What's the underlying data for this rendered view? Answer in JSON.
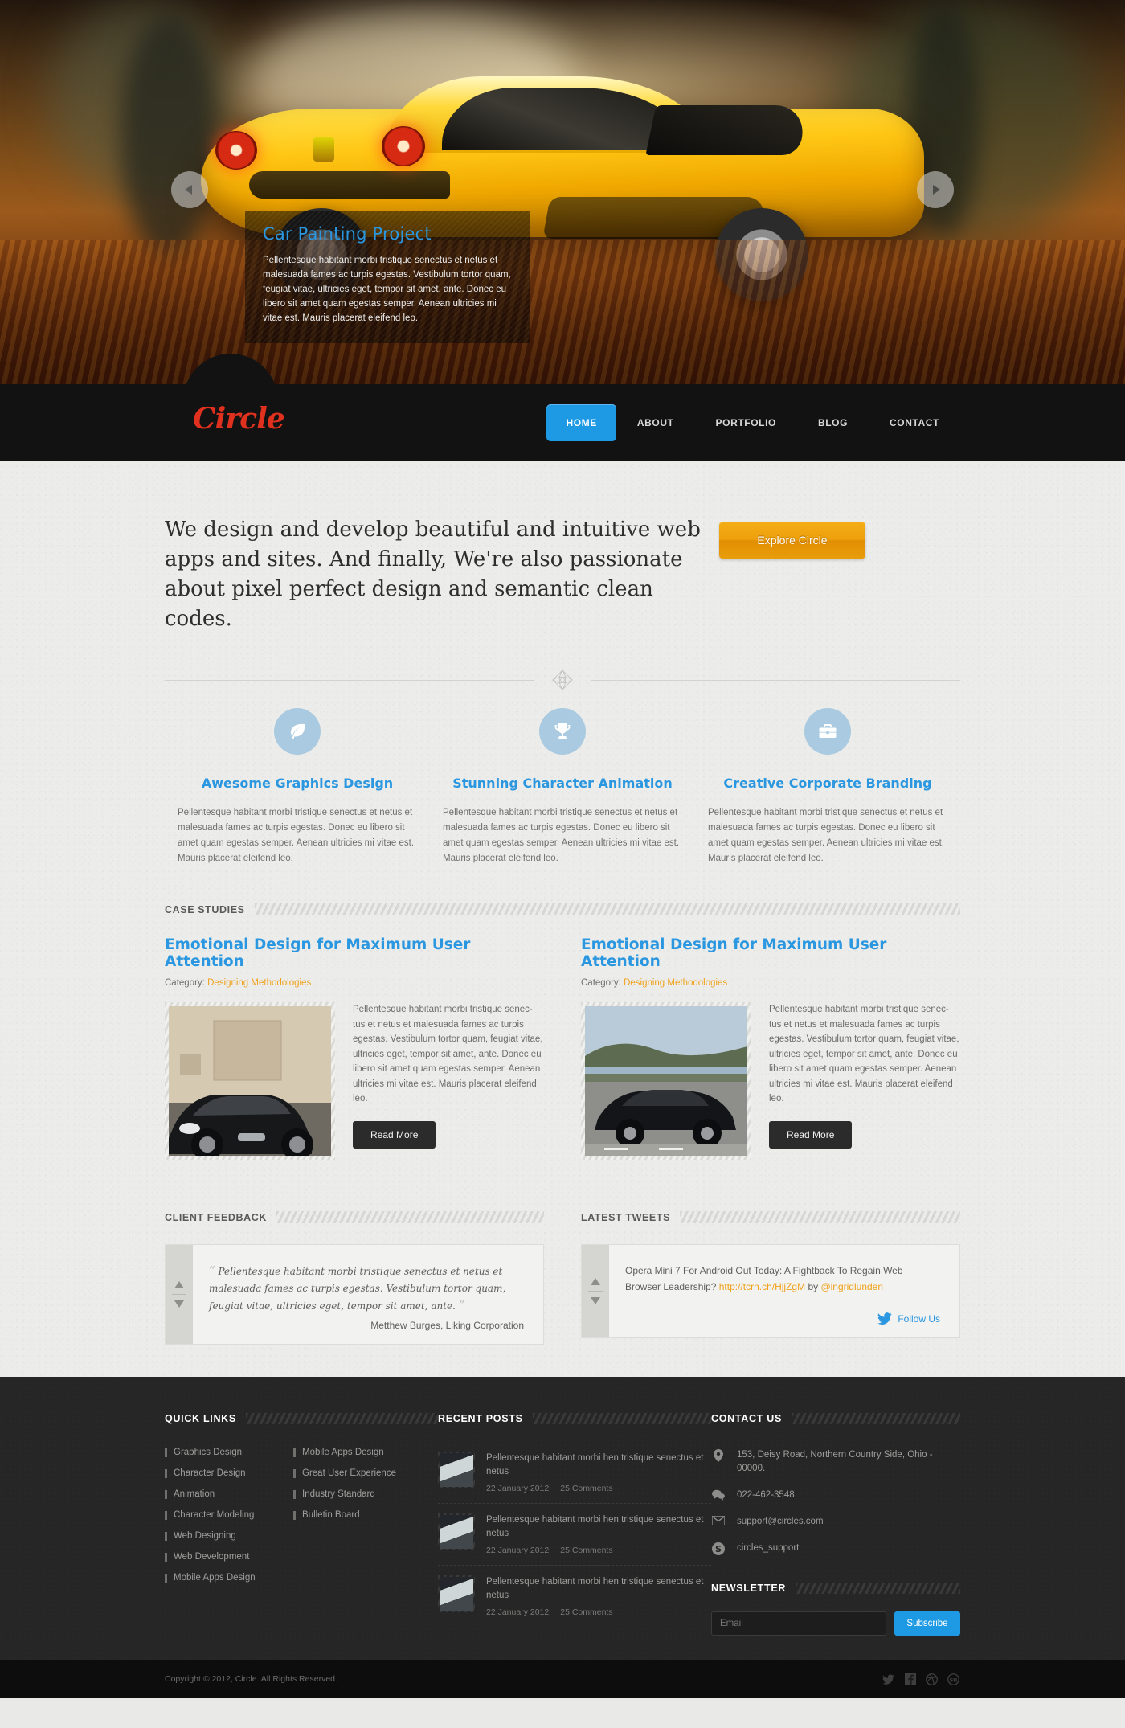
{
  "brand": {
    "logo": "Circle",
    "accent": "#1e9ae4",
    "logo_color": "#e0301e",
    "orange": "#f0a21b"
  },
  "nav": {
    "items": [
      {
        "label": "HOME",
        "active": true
      },
      {
        "label": "ABOUT",
        "active": false
      },
      {
        "label": "PORTFOLIO",
        "active": false
      },
      {
        "label": "BLOG",
        "active": false
      },
      {
        "label": "CONTACT",
        "active": false
      }
    ]
  },
  "slider": {
    "caption_title": "Car Painting Project",
    "caption_text": "Pellentesque habitant morbi tristique senectus et netus et malesuada fames ac turpis egestas. Vestibulum tortor quam, feugiat vitae, ultricies eget, tempor sit amet, ante. Donec eu libero sit amet quam egestas semper. Aenean ultricies mi vitae est. Mauris placerat eleifend leo.",
    "prev_icon": "prev-arrow-icon",
    "next_icon": "next-arrow-icon"
  },
  "intro": {
    "headline": "We design and develop beautiful and intuitive web apps and sites. And finally, We're also passionate about pixel perfect design and semantic clean codes.",
    "button_label": "Explore Circle"
  },
  "services": [
    {
      "icon": "leaf-icon",
      "title": "Awesome Graphics Design",
      "text": "Pellentesque habitant morbi tristique senectus et netus et malesuada fames ac turpis egestas. Donec eu libero sit amet quam egestas semper. Aenean ultricies mi vitae est. Mauris placerat eleifend leo."
    },
    {
      "icon": "trophy-icon",
      "title": "Stunning Character Animation",
      "text": "Pellentesque habitant morbi tristique senectus et netus et malesuada fames ac turpis egestas. Donec eu libero sit amet quam egestas semper. Aenean ultricies mi vitae est. Mauris placerat eleifend leo."
    },
    {
      "icon": "briefcase-icon",
      "title": "Creative Corporate Branding",
      "text": "Pellentesque habitant morbi tristique senectus et netus et malesuada fames ac turpis egestas. Donec eu libero sit amet quam egestas semper. Aenean ultricies mi vitae est. Mauris placerat eleifend leo."
    }
  ],
  "case_studies": {
    "section_title": "CASE STUDIES",
    "items": [
      {
        "title": "Emotional Design for Maximum User Attention",
        "category_label": "Category:",
        "category": "Designing Methodologies",
        "text": "Pellentesque habitant morbi tristique senec-tus et netus et malesuada fames ac turpis egestas. Vestibulum tortor quam, feugiat vitae, ultricies eget, tempor sit amet, ante. Donec eu libero sit amet quam egestas semper. Aenean ultricies mi vitae est. Mauris placerat eleifend leo.",
        "button_label": "Read More",
        "image_alt": "black-coupe-in-garage"
      },
      {
        "title": "Emotional Design for Maximum User Attention",
        "category_label": "Category:",
        "category": "Designing Methodologies",
        "text": "Pellentesque habitant morbi tristique senec-tus et netus et malesuada fames ac turpis egestas. Vestibulum tortor quam, feugiat vitae, ultricies eget, tempor sit amet, ante. Donec eu libero sit amet quam egestas semper. Aenean ultricies mi vitae est. Mauris placerat eleifend leo.",
        "button_label": "Read More",
        "image_alt": "black-sports-car-on-road"
      }
    ]
  },
  "client_feedback": {
    "section_title": "CLIENT FEEDBACK",
    "quote": "Pellentesque habitant morbi tristique senectus et netus et malesuada fames ac turpis egestas. Vestibulum tortor quam, feugiat vitae, ultricies eget, tempor sit amet, ante.",
    "author": "Metthew Burges, Liking Corporation",
    "up_icon": "scroll-up-icon",
    "down_icon": "scroll-down-icon"
  },
  "latest_tweets": {
    "section_title": "LATEST TWEETS",
    "text_before": "Opera Mini 7 For Android Out Today: A Fightback To Regain Web Browser Leadership? ",
    "url": "http://tcrn.ch/HjjZgM",
    "text_middle": " by ",
    "handle": "@ingridlunden",
    "follow_label": "Follow Us",
    "follow_icon": "twitter-bird-icon",
    "up_icon": "scroll-up-icon",
    "down_icon": "scroll-down-icon"
  },
  "footer": {
    "quick_links": {
      "title": "QUICK LINKS",
      "col1": [
        "Graphics Design",
        "Character Design",
        "Animation",
        "Character Modeling",
        "Web Designing",
        "Web Development",
        "Mobile Apps Design"
      ],
      "col2": [
        "Mobile Apps Design",
        "Great User Experience",
        "Industry Standard",
        "Bulletin Board"
      ]
    },
    "recent_posts": {
      "title": "RECENT POSTS",
      "items": [
        {
          "title": "Pellentesque habitant morbi hen tristique senectus et netus",
          "date": "22 January 2012",
          "comments": "25 Comments"
        },
        {
          "title": "Pellentesque habitant morbi hen tristique senectus et netus",
          "date": "22 January 2012",
          "comments": "25 Comments"
        },
        {
          "title": "Pellentesque habitant morbi hen tristique senectus et netus",
          "date": "22 January 2012",
          "comments": "25 Comments"
        }
      ]
    },
    "contact": {
      "title": "CONTACT US",
      "items": [
        {
          "icon": "map-pin-icon",
          "text": "153, Deisy Road, Northern Country Side, Ohio - 00000."
        },
        {
          "icon": "chat-bubble-icon",
          "text": "022-462-3548"
        },
        {
          "icon": "envelope-icon",
          "text": "support@circles.com"
        },
        {
          "icon": "skype-icon",
          "text": "circles_support"
        }
      ]
    },
    "newsletter": {
      "title": "NEWSLETTER",
      "placeholder": "Email",
      "value": "",
      "button_label": "Subscribe"
    },
    "copyright": "Copyright © 2012, Circle. All Rights Reserved.",
    "socials": [
      {
        "icon": "twitter-icon"
      },
      {
        "icon": "facebook-icon"
      },
      {
        "icon": "dribbble-icon"
      },
      {
        "icon": "stumbleupon-icon"
      }
    ]
  }
}
